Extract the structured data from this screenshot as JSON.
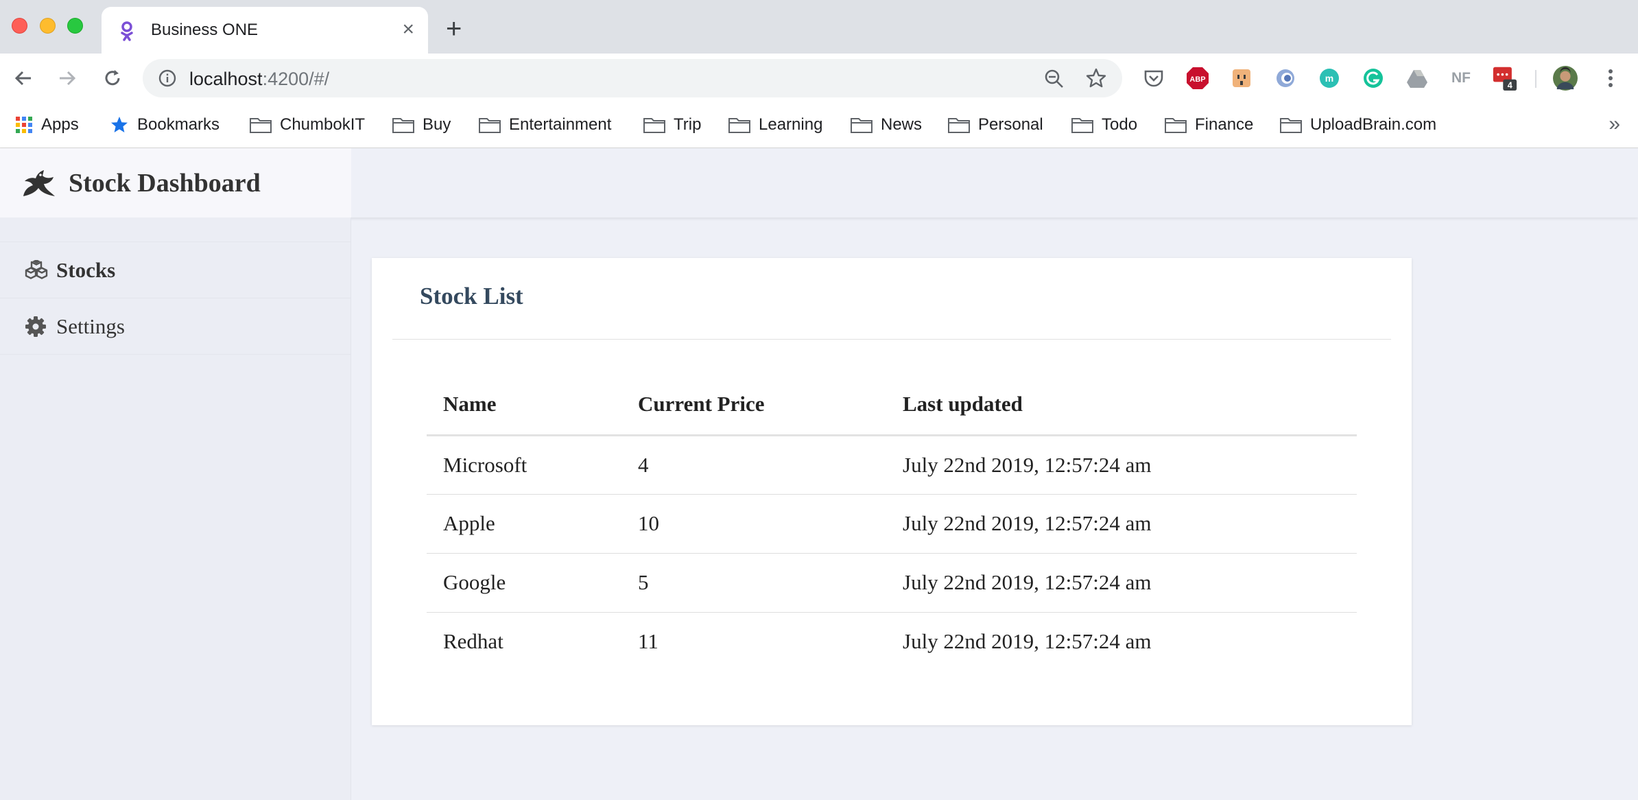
{
  "browser": {
    "tab": {
      "title": "Business ONE",
      "close": "×"
    },
    "new_tab": "+",
    "address": {
      "host": "localhost",
      "rest": ":4200/#/"
    },
    "extensions": [
      "pocket-icon",
      "adblock-icon",
      "extension-face-icon",
      "extension-ring-icon",
      "mercury-icon",
      "grammarly-icon",
      "google-drive-icon",
      "nf-icon",
      "extension-badge-icon"
    ],
    "nf_label": "NF",
    "abp_label": "ABP",
    "badge_count": "4",
    "bookmarks": [
      {
        "label": "Apps",
        "icon": "apps-grid-icon"
      },
      {
        "label": "Bookmarks",
        "icon": "star-icon"
      },
      {
        "label": "ChumbokIT",
        "icon": "folder-icon"
      },
      {
        "label": "Buy",
        "icon": "folder-icon"
      },
      {
        "label": "Entertainment",
        "icon": "folder-icon"
      },
      {
        "label": "Trip",
        "icon": "folder-icon"
      },
      {
        "label": "Learning",
        "icon": "folder-icon"
      },
      {
        "label": "News",
        "icon": "folder-icon"
      },
      {
        "label": "Personal",
        "icon": "folder-icon"
      },
      {
        "label": "Todo",
        "icon": "folder-icon"
      },
      {
        "label": "Finance",
        "icon": "folder-icon"
      },
      {
        "label": "UploadBrain.com",
        "icon": "folder-icon"
      }
    ],
    "bookmarks_more": "»"
  },
  "app": {
    "title": "Stock Dashboard",
    "sidebar": {
      "items": [
        {
          "label": "Stocks",
          "icon": "cubes-icon",
          "active": true
        },
        {
          "label": "Settings",
          "icon": "gear-icon",
          "active": false
        }
      ]
    },
    "card": {
      "title": "Stock List",
      "columns": [
        "Name",
        "Current Price",
        "Last updated"
      ],
      "rows": [
        {
          "name": "Microsoft",
          "price": "4",
          "updated": "July 22nd 2019, 12:57:24 am"
        },
        {
          "name": "Apple",
          "price": "10",
          "updated": "July 22nd 2019, 12:57:24 am"
        },
        {
          "name": "Google",
          "price": "5",
          "updated": "July 22nd 2019, 12:57:24 am"
        },
        {
          "name": "Redhat",
          "price": "11",
          "updated": "July 22nd 2019, 12:57:24 am"
        }
      ]
    }
  },
  "colors": {
    "page_bg": "#eef0f7",
    "sidebar_bg": "#ebedf4",
    "card_title": "#34495e",
    "tab_favicon": "#7b4fd6"
  }
}
